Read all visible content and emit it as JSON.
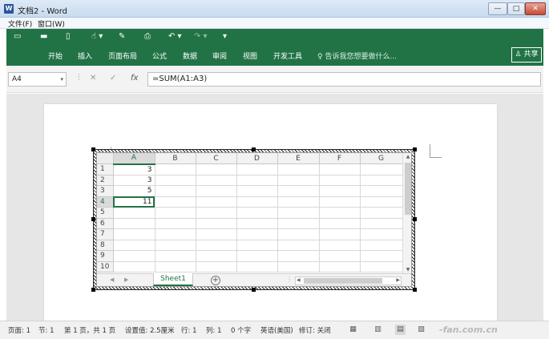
{
  "window": {
    "title": "文档2 - Word",
    "app_icon_letter": "W",
    "minimize": "—",
    "maximize": "□",
    "close": "✕"
  },
  "menu": [
    "文件(F)",
    "窗口(W)"
  ],
  "qat": {
    "save": "▭",
    "open": "▬",
    "new": "▯",
    "touch": "☝ ▾",
    "format": "✎",
    "preview": "⎙",
    "undo": "↶ ▾",
    "redo": "↷ ▾",
    "customize": "▾"
  },
  "ribbon_tabs": [
    "开始",
    "插入",
    "页面布局",
    "公式",
    "数据",
    "审阅",
    "视图",
    "开发工具"
  ],
  "tell_me": "♀ 告诉我您想要做什么...",
  "share": "♙ 共享",
  "formula_bar": {
    "name_box": "A4",
    "name_box_arrow": "▾",
    "sep": "⋮",
    "cancel": "✕",
    "enter": "✓",
    "fx": "fx",
    "formula": "=SUM(A1:A3)"
  },
  "sheet": {
    "columns": [
      "A",
      "B",
      "C",
      "D",
      "E",
      "F",
      "G"
    ],
    "rows": [
      {
        "num": "1",
        "a": "3"
      },
      {
        "num": "2",
        "a": "3"
      },
      {
        "num": "3",
        "a": "5"
      },
      {
        "num": "4",
        "a": "11"
      },
      {
        "num": "5",
        "a": ""
      },
      {
        "num": "6",
        "a": ""
      },
      {
        "num": "7",
        "a": ""
      },
      {
        "num": "8",
        "a": ""
      },
      {
        "num": "9",
        "a": ""
      },
      {
        "num": "10",
        "a": ""
      }
    ],
    "tab_name": "Sheet1",
    "add_sheet": "+",
    "nav_prev": "◀",
    "nav_next": "▶",
    "scroll_up": "▲",
    "scroll_down": "▼",
    "scroll_left": "◀",
    "scroll_right": "▶"
  },
  "status": {
    "page": "页面: 1",
    "section": "节: 1",
    "pages": "第 1 页，共 1 页",
    "position": "设置值: 2.5厘米",
    "line": "行: 1",
    "column": "列: 1",
    "words": "0 个字",
    "language": "英语(美国)",
    "track": "修订: 关闭",
    "macro": "▦",
    "read_mode": "▥",
    "print_layout": "▤",
    "web_layout": "▧"
  },
  "watermark": "-fan.com.cn"
}
